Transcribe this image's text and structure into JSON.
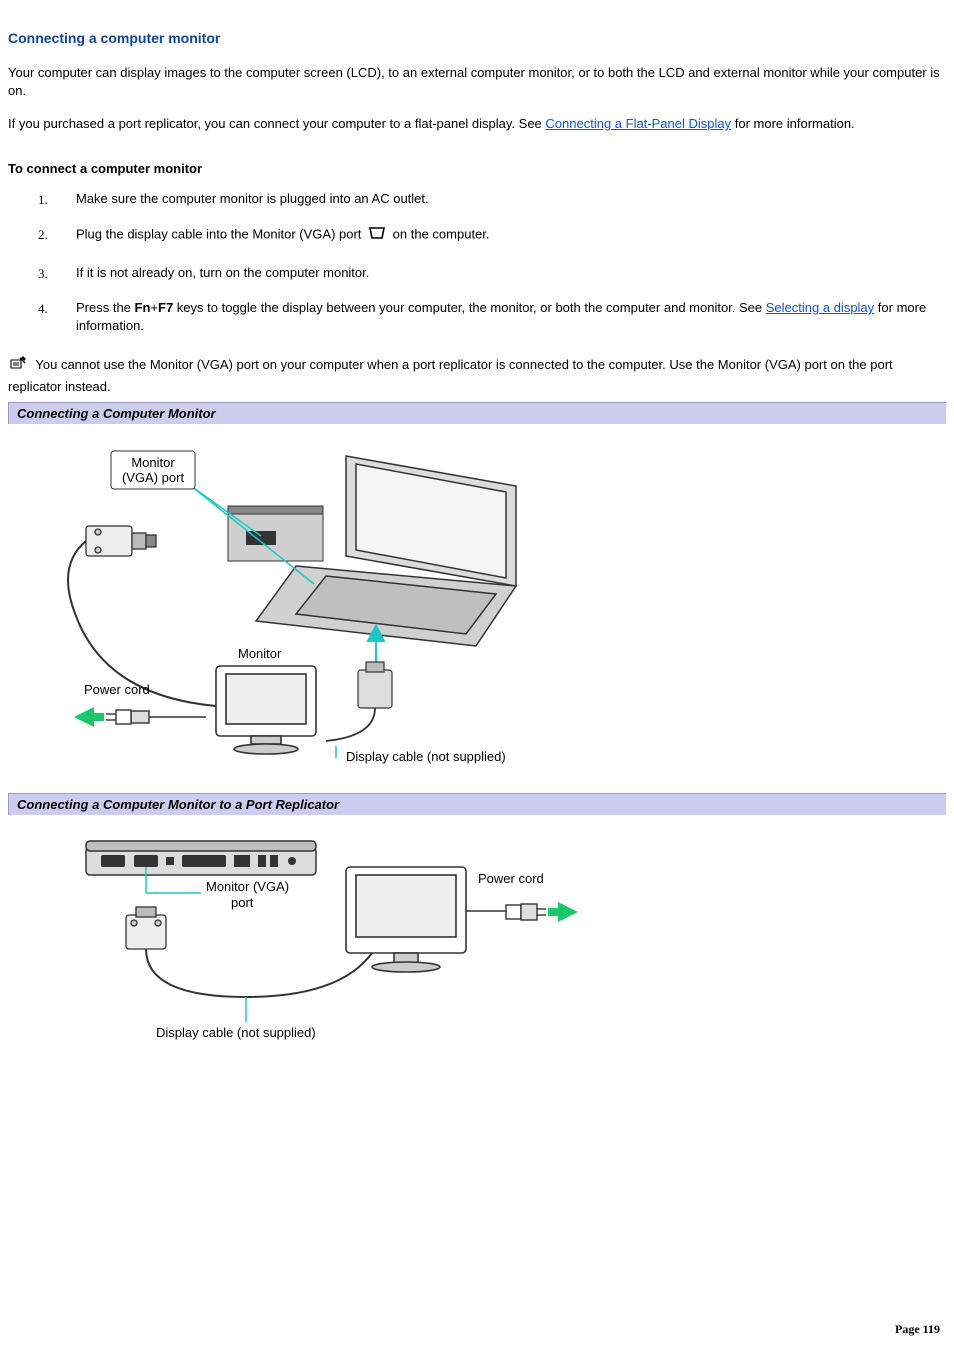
{
  "heading": "Connecting a computer monitor",
  "intro_p1": "Your computer can display images to the computer screen (LCD), to an external computer monitor, or to both the LCD and external monitor while your computer is on.",
  "intro_p2_a": "If you purchased a port replicator, you can connect your computer to a flat-panel display. See ",
  "intro_p2_link": "Connecting a Flat-Panel Display",
  "intro_p2_b": " for more information.",
  "sub_heading": "To connect a computer monitor",
  "steps": {
    "s1": "Make sure the computer monitor is plugged into an AC outlet.",
    "s2_a": "Plug the display cable into the Monitor (VGA) port ",
    "s2_b": " on the computer.",
    "s3": "If it is not already on, turn on the computer monitor.",
    "s4_a": "Press the ",
    "s4_key1": "Fn",
    "s4_plus": "+",
    "s4_key2": "F7",
    "s4_b": " keys to toggle the display between your computer, the monitor, or both the computer and monitor. See ",
    "s4_link": "Selecting a display",
    "s4_c": " for more information."
  },
  "note_text": "You cannot use the Monitor (VGA) port on your computer when a port replicator is connected to the computer. Use the Monitor (VGA) port on the port replicator instead.",
  "figure1": {
    "title": "Connecting a Computer Monitor",
    "labels": {
      "vga_port": "Monitor\n(VGA) port",
      "monitor": "Monitor",
      "power_cord": "Power cord",
      "display_cable": "Display cable (not supplied)"
    }
  },
  "figure2": {
    "title": "Connecting a Computer Monitor to a Port Replicator",
    "labels": {
      "vga_port": "Monitor (VGA)\nport",
      "power_cord": "Power cord",
      "display_cable": "Display cable (not supplied)"
    }
  },
  "page_footer": "Page 119"
}
